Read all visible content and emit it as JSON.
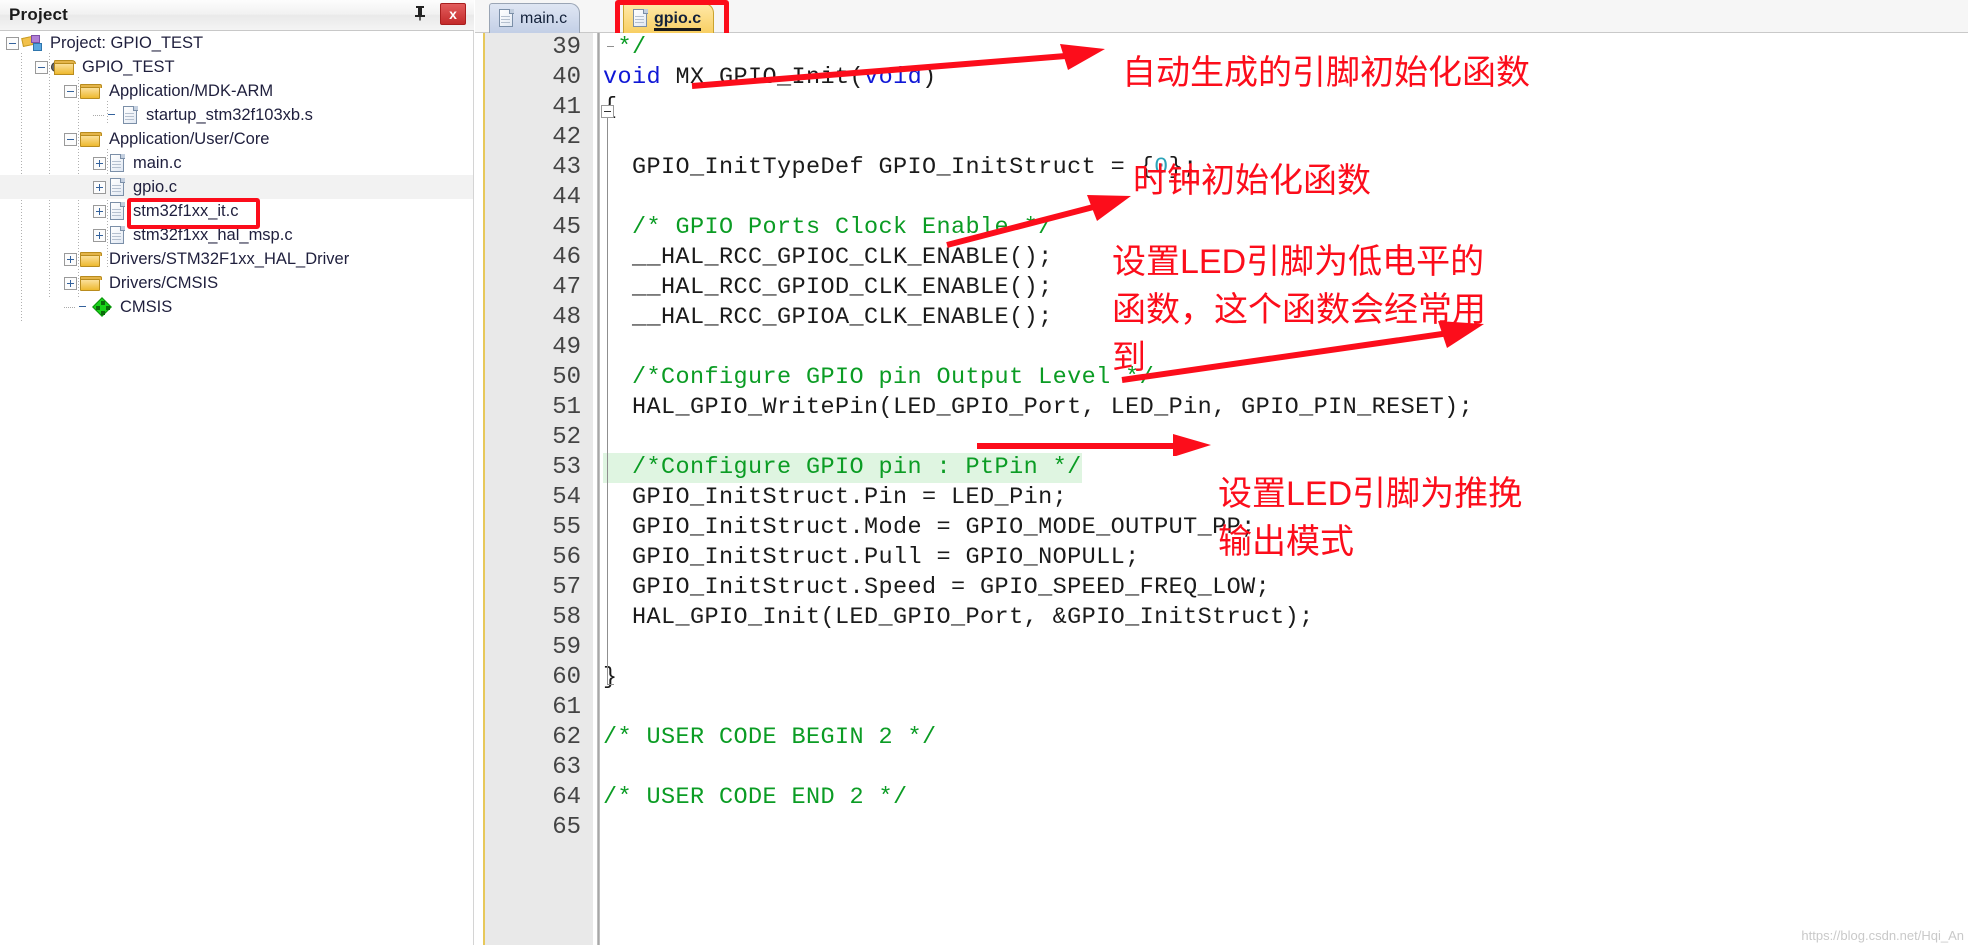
{
  "project_panel": {
    "title": "Project",
    "pin_icon": "pin-icon",
    "close_icon": "close-icon",
    "tree": [
      {
        "label": "Project: GPIO_TEST",
        "icon": "project-icon",
        "indent": 0,
        "twisty": "minus",
        "selected": false
      },
      {
        "label": "GPIO_TEST",
        "icon": "target-folder-icon",
        "indent": 1,
        "twisty": "minus",
        "selected": false
      },
      {
        "label": "Application/MDK-ARM",
        "icon": "folder-icon",
        "indent": 2,
        "twisty": "minus",
        "selected": false
      },
      {
        "label": "startup_stm32f103xb.s",
        "icon": "file-icon",
        "indent": 3,
        "twisty": "none",
        "selected": false
      },
      {
        "label": "Application/User/Core",
        "icon": "folder-icon",
        "indent": 2,
        "twisty": "minus",
        "selected": false
      },
      {
        "label": "main.c",
        "icon": "file-icon",
        "indent": 3,
        "twisty": "plus",
        "selected": false
      },
      {
        "label": "gpio.c",
        "icon": "file-icon",
        "indent": 3,
        "twisty": "plus",
        "selected": true
      },
      {
        "label": "stm32f1xx_it.c",
        "icon": "file-icon",
        "indent": 3,
        "twisty": "plus",
        "selected": false
      },
      {
        "label": "stm32f1xx_hal_msp.c",
        "icon": "file-icon",
        "indent": 3,
        "twisty": "plus",
        "selected": false
      },
      {
        "label": "Drivers/STM32F1xx_HAL_Driver",
        "icon": "folder-icon",
        "indent": 2,
        "twisty": "plus",
        "selected": false
      },
      {
        "label": "Drivers/CMSIS",
        "icon": "folder-icon",
        "indent": 2,
        "twisty": "plus",
        "selected": false
      },
      {
        "label": "CMSIS",
        "icon": "cmsis-icon",
        "indent": 2,
        "twisty": "none",
        "selected": false
      }
    ]
  },
  "editor": {
    "tabs": [
      {
        "label": "main.c",
        "active": false
      },
      {
        "label": "gpio.c",
        "active": true
      }
    ],
    "lines": [
      {
        "num": "39",
        "text": " */",
        "cls": "cm",
        "hl": false
      },
      {
        "num": "40",
        "text": "void MX_GPIO_Init(void)",
        "cls": "",
        "hl": false
      },
      {
        "num": "41",
        "text": "{",
        "cls": "",
        "hl": false
      },
      {
        "num": "42",
        "text": "",
        "cls": "",
        "hl": false
      },
      {
        "num": "43",
        "text": "  GPIO_InitTypeDef GPIO_InitStruct = {0};",
        "cls": "",
        "hl": false
      },
      {
        "num": "44",
        "text": "",
        "cls": "",
        "hl": false
      },
      {
        "num": "45",
        "text": "  /* GPIO Ports Clock Enable */",
        "cls": "cm",
        "hl": false
      },
      {
        "num": "46",
        "text": "  __HAL_RCC_GPIOC_CLK_ENABLE();",
        "cls": "",
        "hl": false
      },
      {
        "num": "47",
        "text": "  __HAL_RCC_GPIOD_CLK_ENABLE();",
        "cls": "",
        "hl": false
      },
      {
        "num": "48",
        "text": "  __HAL_RCC_GPIOA_CLK_ENABLE();",
        "cls": "",
        "hl": false
      },
      {
        "num": "49",
        "text": "",
        "cls": "",
        "hl": false
      },
      {
        "num": "50",
        "text": "  /*Configure GPIO pin Output Level */",
        "cls": "cm",
        "hl": false
      },
      {
        "num": "51",
        "text": "  HAL_GPIO_WritePin(LED_GPIO_Port, LED_Pin, GPIO_PIN_RESET);",
        "cls": "",
        "hl": false
      },
      {
        "num": "52",
        "text": "",
        "cls": "",
        "hl": false
      },
      {
        "num": "53",
        "text": "  /*Configure GPIO pin : PtPin */",
        "cls": "cm",
        "hl": true
      },
      {
        "num": "54",
        "text": "  GPIO_InitStruct.Pin = LED_Pin;",
        "cls": "",
        "hl": false
      },
      {
        "num": "55",
        "text": "  GPIO_InitStruct.Mode = GPIO_MODE_OUTPUT_PP;",
        "cls": "",
        "hl": false
      },
      {
        "num": "56",
        "text": "  GPIO_InitStruct.Pull = GPIO_NOPULL;",
        "cls": "",
        "hl": false
      },
      {
        "num": "57",
        "text": "  GPIO_InitStruct.Speed = GPIO_SPEED_FREQ_LOW;",
        "cls": "",
        "hl": false
      },
      {
        "num": "58",
        "text": "  HAL_GPIO_Init(LED_GPIO_Port, &GPIO_InitStruct);",
        "cls": "",
        "hl": false
      },
      {
        "num": "59",
        "text": "",
        "cls": "",
        "hl": false
      },
      {
        "num": "60",
        "text": "}",
        "cls": "",
        "hl": false
      },
      {
        "num": "61",
        "text": "",
        "cls": "",
        "hl": false
      },
      {
        "num": "62",
        "text": "/* USER CODE BEGIN 2 */",
        "cls": "cm",
        "hl": false
      },
      {
        "num": "63",
        "text": "",
        "cls": "",
        "hl": false
      },
      {
        "num": "64",
        "text": "/* USER CODE END 2 */",
        "cls": "cm",
        "hl": false
      },
      {
        "num": "65",
        "text": "",
        "cls": "",
        "hl": false
      }
    ]
  },
  "annotations": [
    {
      "id": "anno-auto-gen",
      "text": "自动生成的引脚初始化函数"
    },
    {
      "id": "anno-clock-init",
      "text": "时钟初始化函数"
    },
    {
      "id": "anno-led-low",
      "text": "设置LED引脚为低电平的\n函数，这个函数会经常用\n到"
    },
    {
      "id": "anno-push-pull",
      "text": "设置LED引脚为推挽\n输出模式"
    }
  ],
  "watermark": "https://blog.csdn.net/Hqi_An",
  "colors": {
    "annotation_red": "#fc0d1b",
    "comment_green": "#0b9c24",
    "keyword_blue": "#0f17d6",
    "number_teal": "#2aa3b8",
    "active_tab": "#f8cf63",
    "highlight_line": "#dff5e1"
  }
}
